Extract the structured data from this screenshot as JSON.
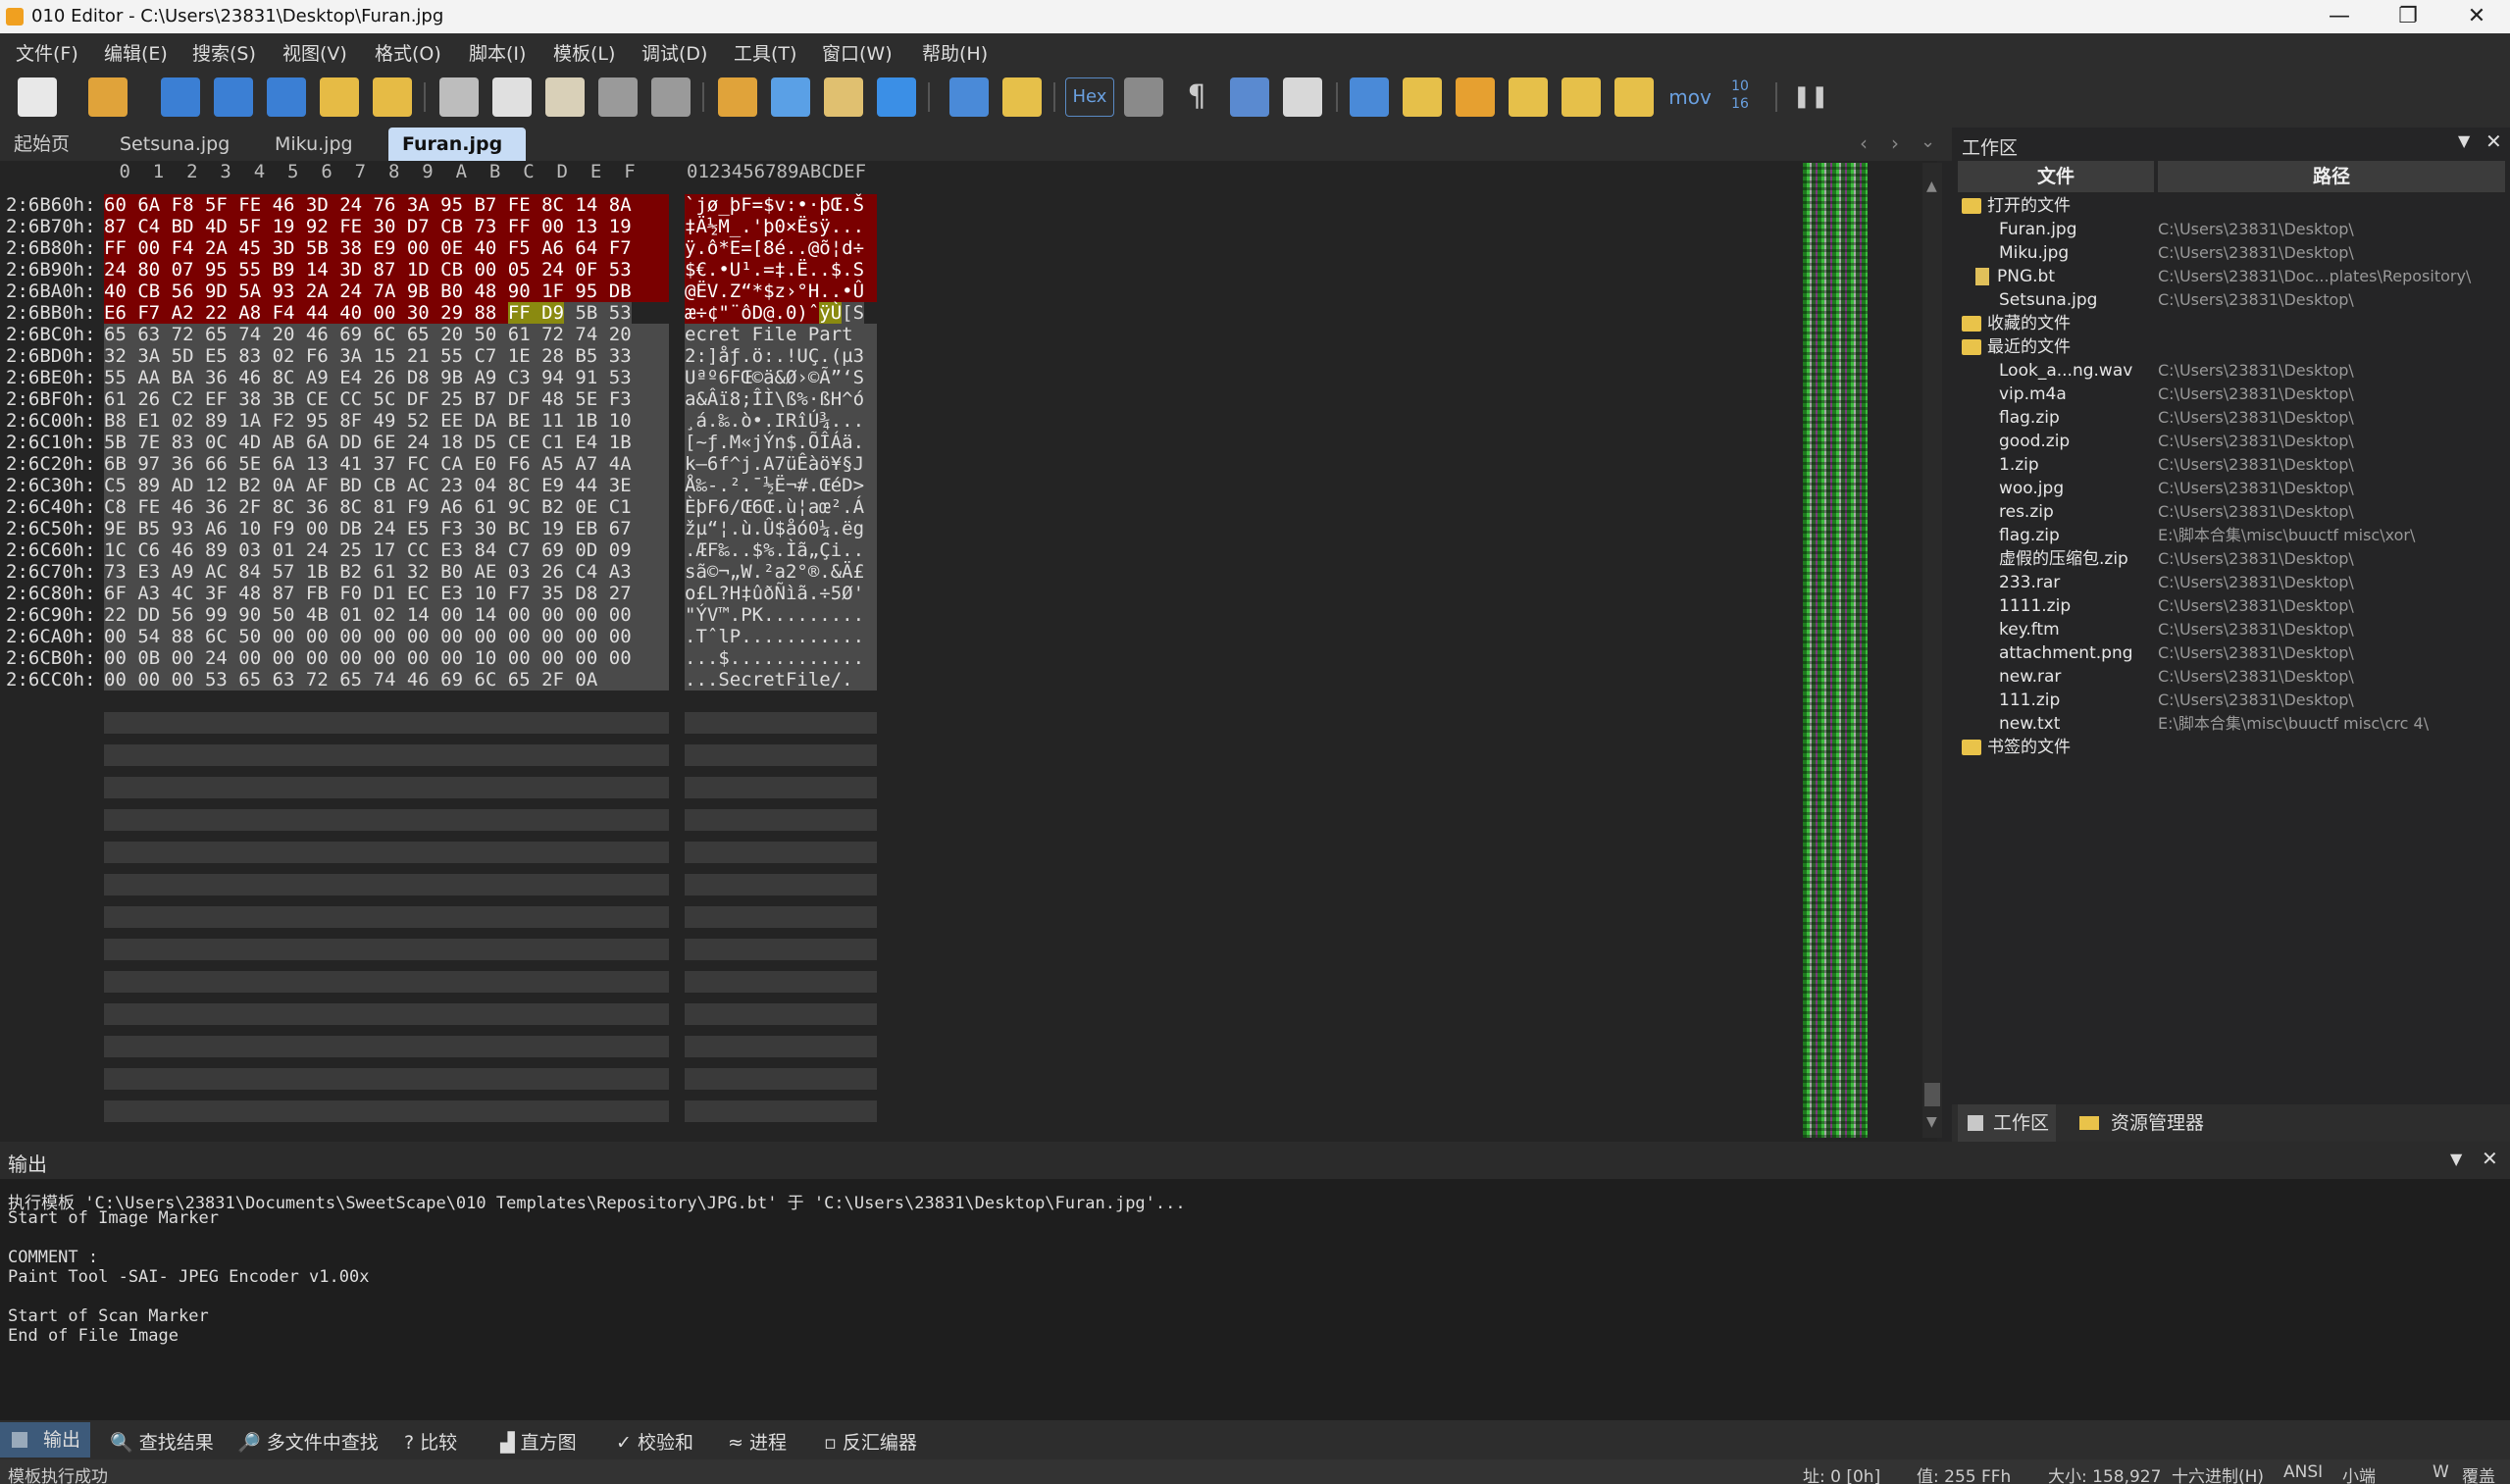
{
  "titlebar": {
    "title": "010 Editor - C:\\Users\\23831\\Desktop\\Furan.jpg",
    "minimize": "—",
    "maximize": "❐",
    "close": "✕"
  },
  "menu": [
    "文件(F)",
    "编辑(E)",
    "搜索(S)",
    "视图(V)",
    "格式(O)",
    "脚本(I)",
    "模板(L)",
    "调试(D)",
    "工具(T)",
    "窗口(W)",
    "帮助(H)"
  ],
  "toolbar": {
    "hex_label": "Hex",
    "mov_label": "mov",
    "conv_label": "10\n16",
    "icons": [
      "new-file-icon",
      "open-file-icon",
      "save-icon",
      "save-as-icon",
      "save-all-icon",
      "open-folder-icon",
      "open-workspace-icon",
      "cut-icon",
      "copy-icon",
      "paste-icon",
      "undo-icon",
      "redo-icon",
      "find-icon",
      "replace-icon",
      "find-in-files-icon",
      "goto-icon",
      "run-script-icon",
      "run-template-icon",
      "hex-icon",
      "text-format-icon",
      "pilcrow-icon",
      "columns-icon",
      "highlight-icon",
      "calculator-icon",
      "help-icon",
      "compare-icon",
      "histogram-icon",
      "checksum-icon",
      "check-icon",
      "disassembler-icon",
      "base-converter-icon",
      "pause-icon"
    ]
  },
  "tabs": {
    "items": [
      "起始页",
      "Setsuna.jpg",
      "Miku.jpg",
      "Furan.jpg"
    ],
    "active": "Furan.jpg",
    "close": "✕"
  },
  "hex": {
    "col_header": " 0  1  2  3  4  5  6  7  8  9  A  B  C  D  E  F",
    "ascii_header": "0123456789ABCDEF",
    "rows": [
      {
        "addr": "2:6B60h:",
        "hex": "60 6A F8 5F FE 46 3D 24 76 3A 95 B7 FE 8C 14 8A",
        "ascii": "`jø_þF=$v:•·þŒ.Š",
        "style": "red"
      },
      {
        "addr": "2:6B70h:",
        "hex": "87 C4 BD 4D 5F 19 92 FE 30 D7 CB 73 FF 00 13 19",
        "ascii": "‡Ä½M_.'þ0×Ësÿ...",
        "style": "red"
      },
      {
        "addr": "2:6B80h:",
        "hex": "FF 00 F4 2A 45 3D 5B 38 E9 00 0E 40 F5 A6 64 F7",
        "ascii": "ÿ.ô*E=[8é..@õ¦d÷",
        "style": "red"
      },
      {
        "addr": "2:6B90h:",
        "hex": "24 80 07 95 55 B9 14 3D 87 1D CB 00 05 24 0F 53",
        "ascii": "$€.•U¹.=‡.Ë..$.S",
        "style": "red"
      },
      {
        "addr": "2:6BA0h:",
        "hex": "40 CB 56 9D 5A 93 2A 24 7A 9B B0 48 90 1F 95 DB",
        "ascii": "@ËV.Z“*$z›°H..•Û",
        "style": "red"
      },
      {
        "addr": "2:6BB0h:",
        "hex": "E6 F7 A2 22 A8 F4 44 40 00 30 29 88 FF D9 5B 53",
        "ascii": "æ÷¢\"¨ôD@.0)ˆÿÙ[S",
        "style": "mixed"
      },
      {
        "addr": "2:6BC0h:",
        "hex": "65 63 72 65 74 20 46 69 6C 65 20 50 61 72 74 20",
        "ascii": "ecret File Part ",
        "style": "gry"
      },
      {
        "addr": "2:6BD0h:",
        "hex": "32 3A 5D E5 83 02 F6 3A 15 21 55 C7 1E 28 B5 33",
        "ascii": "2:]åƒ.ö:.!UÇ.(µ3",
        "style": "gry"
      },
      {
        "addr": "2:6BE0h:",
        "hex": "55 AA BA 36 46 8C A9 E4 26 D8 9B A9 C3 94 91 53",
        "ascii": "Uªº6FŒ©ä&Ø›©Ã”‘S",
        "style": "gry"
      },
      {
        "addr": "2:6BF0h:",
        "hex": "61 26 C2 EF 38 3B CE CC 5C DF 25 B7 DF 48 5E F3",
        "ascii": "a&Âï8;ÎÌ\\ß%·ßH^ó",
        "style": "gry"
      },
      {
        "addr": "2:6C00h:",
        "hex": "B8 E1 02 89 1A F2 95 8F 49 52 EE DA BE 11 1B 10",
        "ascii": "¸á.‰.ò•.IRîÚ¾...",
        "style": "gry"
      },
      {
        "addr": "2:6C10h:",
        "hex": "5B 7E 83 0C 4D AB 6A DD 6E 24 18 D5 CE C1 E4 1B",
        "ascii": "[~ƒ.M«jÝn$.ÕÎÁä.",
        "style": "gry"
      },
      {
        "addr": "2:6C20h:",
        "hex": "6B 97 36 66 5E 6A 13 41 37 FC CA E0 F6 A5 A7 4A",
        "ascii": "k—6f^j.A7üÊàö¥§J",
        "style": "gry"
      },
      {
        "addr": "2:6C30h:",
        "hex": "C5 89 AD 12 B2 0A AF BD CB AC 23 04 8C E9 44 3E",
        "ascii": "Å‰-.².¯½Ë¬#.ŒéD>",
        "style": "gry"
      },
      {
        "addr": "2:6C40h:",
        "hex": "C8 FE 46 36 2F 8C 36 8C 81 F9 A6 61 9C B2 0E C1",
        "ascii": "ÈþF6/Œ6Œ.ù¦aœ².Á",
        "style": "gry"
      },
      {
        "addr": "2:6C50h:",
        "hex": "9E B5 93 A6 10 F9 00 DB 24 E5 F3 30 BC 19 EB 67",
        "ascii": "žµ“¦.ù.Û$åó0¼.ëg",
        "style": "gry"
      },
      {
        "addr": "2:6C60h:",
        "hex": "1C C6 46 89 03 01 24 25 17 CC E3 84 C7 69 0D 09",
        "ascii": ".ÆF‰..$%.Ìã„Çi..",
        "style": "gry"
      },
      {
        "addr": "2:6C70h:",
        "hex": "73 E3 A9 AC 84 57 1B B2 61 32 B0 AE 03 26 C4 A3",
        "ascii": "sã©¬„W.²a2°®.&Ä£",
        "style": "gry"
      },
      {
        "addr": "2:6C80h:",
        "hex": "6F A3 4C 3F 48 87 FB F0 D1 EC E3 10 F7 35 D8 27",
        "ascii": "o£L?H‡ûðÑìã.÷5Ø'",
        "style": "gry"
      },
      {
        "addr": "2:6C90h:",
        "hex": "22 DD 56 99 90 50 4B 01 02 14 00 14 00 00 00 00",
        "ascii": "\"ÝV™.PK.........",
        "style": "gry"
      },
      {
        "addr": "2:6CA0h:",
        "hex": "00 54 88 6C 50 00 00 00 00 00 00 00 00 00 00 00",
        "ascii": ".TˆlP...........",
        "style": "gry"
      },
      {
        "addr": "2:6CB0h:",
        "hex": "00 0B 00 24 00 00 00 00 00 00 00 10 00 00 00 00",
        "ascii": "...$............",
        "style": "gry"
      },
      {
        "addr": "2:6CC0h:",
        "hex": "00 00 00 53 65 63 72 65 74 46 69 6C 65 2F 0A",
        "ascii": "...SecretFile/.",
        "style": "gry"
      }
    ]
  },
  "workspace": {
    "title": "工作区",
    "col_file": "文件",
    "col_path": "路径",
    "groups": [
      {
        "label": "打开的文件",
        "items": [
          {
            "name": "Furan.jpg",
            "path": "C:\\Users\\23831\\Desktop\\"
          },
          {
            "name": "Miku.jpg",
            "path": "C:\\Users\\23831\\Desktop\\"
          },
          {
            "name": "PNG.bt",
            "path": "C:\\Users\\23831\\Doc...plates\\Repository\\",
            "bt": true
          },
          {
            "name": "Setsuna.jpg",
            "path": "C:\\Users\\23831\\Desktop\\"
          }
        ]
      },
      {
        "label": "收藏的文件",
        "items": []
      },
      {
        "label": "最近的文件",
        "items": [
          {
            "name": "Look_a...ng.wav",
            "path": "C:\\Users\\23831\\Desktop\\"
          },
          {
            "name": "vip.m4a",
            "path": "C:\\Users\\23831\\Desktop\\"
          },
          {
            "name": "flag.zip",
            "path": "C:\\Users\\23831\\Desktop\\"
          },
          {
            "name": "good.zip",
            "path": "C:\\Users\\23831\\Desktop\\"
          },
          {
            "name": "1.zip",
            "path": "C:\\Users\\23831\\Desktop\\"
          },
          {
            "name": "woo.jpg",
            "path": "C:\\Users\\23831\\Desktop\\"
          },
          {
            "name": "res.zip",
            "path": "C:\\Users\\23831\\Desktop\\"
          },
          {
            "name": "flag.zip",
            "path": "E:\\脚本合集\\misc\\buuctf misc\\xor\\"
          },
          {
            "name": "虚假的压缩包.zip",
            "path": "C:\\Users\\23831\\Desktop\\"
          },
          {
            "name": "233.rar",
            "path": "C:\\Users\\23831\\Desktop\\"
          },
          {
            "name": "1111.zip",
            "path": "C:\\Users\\23831\\Desktop\\"
          },
          {
            "name": "key.ftm",
            "path": "C:\\Users\\23831\\Desktop\\"
          },
          {
            "name": "attachment.png",
            "path": "C:\\Users\\23831\\Desktop\\"
          },
          {
            "name": "new.rar",
            "path": "C:\\Users\\23831\\Desktop\\"
          },
          {
            "name": "111.zip",
            "path": "C:\\Users\\23831\\Desktop\\"
          },
          {
            "name": "new.txt",
            "path": "E:\\脚本合集\\misc\\buuctf misc\\crc 4\\"
          }
        ]
      },
      {
        "label": "书签的文件",
        "items": []
      }
    ],
    "tab_workspace": "工作区",
    "tab_explorer": "资源管理器"
  },
  "output": {
    "title": "输出",
    "lines": [
      "执行模板 'C:\\Users\\23831\\Documents\\SweetScape\\010 Templates\\Repository\\JPG.bt' 于 'C:\\Users\\23831\\Desktop\\Furan.jpg'...",
      "Start of Image Marker",
      "",
      "COMMENT :",
      "Paint Tool -SAI- JPEG Encoder v1.00x",
      "",
      "Start of Scan Marker",
      "End of File Image"
    ]
  },
  "bottom_tabs": [
    "输出",
    "查找结果",
    "多文件中查找",
    "比较",
    "直方图",
    "校验和",
    "进程",
    "反汇编器"
  ],
  "status": {
    "left": "模板执行成功",
    "pos": "址: 0 [0h]",
    "value": "值: 255 FFh",
    "size": "大小: 158,927",
    "mode": "十六进制(H)",
    "enc": "ANSI",
    "endian": "小端",
    "w": "W",
    "extra": "覆盖"
  },
  "colors": {
    "red_hl": "#7a0000",
    "gray_hl": "#4a4a4a",
    "yellow_hl": "#8a8a10",
    "active_tab": "#c7dcf5"
  }
}
